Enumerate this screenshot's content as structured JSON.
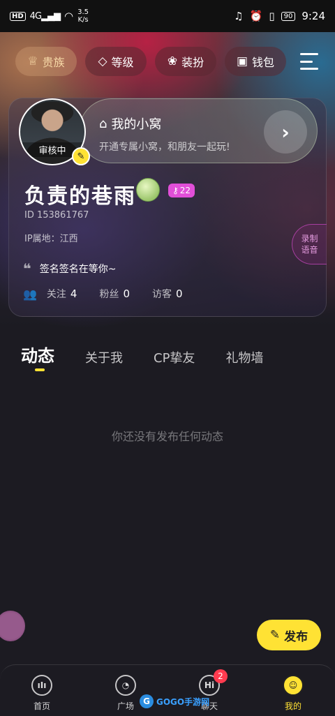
{
  "status_bar": {
    "hd": "HD",
    "net": "4G",
    "speed_value": "3.5",
    "speed_unit": "K/s",
    "battery": "90",
    "time": "9:24"
  },
  "topnav": {
    "items": [
      {
        "label": "贵族",
        "icon": "crown-icon"
      },
      {
        "label": "等级",
        "icon": "gem-icon"
      },
      {
        "label": "装扮",
        "icon": "bow-icon"
      },
      {
        "label": "钱包",
        "icon": "wallet-icon"
      }
    ]
  },
  "profile": {
    "avatar_status": "审核中",
    "nest_title": "我的小窝",
    "nest_subtitle": "开通专属小窝，和朋友一起玩!",
    "username": "负责的巷雨",
    "level": "22",
    "id_text": "ID  153861767",
    "ip_text": "IP属地：江西",
    "record_label_1": "录制",
    "record_label_2": "语音",
    "signature": "签名签名在等你~",
    "stats": [
      {
        "label": "关注",
        "value": "4"
      },
      {
        "label": "粉丝",
        "value": "0"
      },
      {
        "label": "访客",
        "value": "0"
      }
    ]
  },
  "tabs": [
    "动态",
    "关于我",
    "CP挚友",
    "礼物墙"
  ],
  "empty_text": "你还没有发布任何动态",
  "publish_label": "发布",
  "bottom_nav": [
    {
      "label": "首页",
      "icon": "home-wave-icon"
    },
    {
      "label": "广场",
      "icon": "plaza-icon"
    },
    {
      "label": "聊天",
      "icon": "chat-hi-icon",
      "badge": "2"
    },
    {
      "label": "我的",
      "icon": "me-face-icon"
    }
  ],
  "watermark": "GOGO手游网",
  "colors": {
    "accent": "#ffe234",
    "badge": "#ff3b4f",
    "level": "#e14fd8"
  }
}
